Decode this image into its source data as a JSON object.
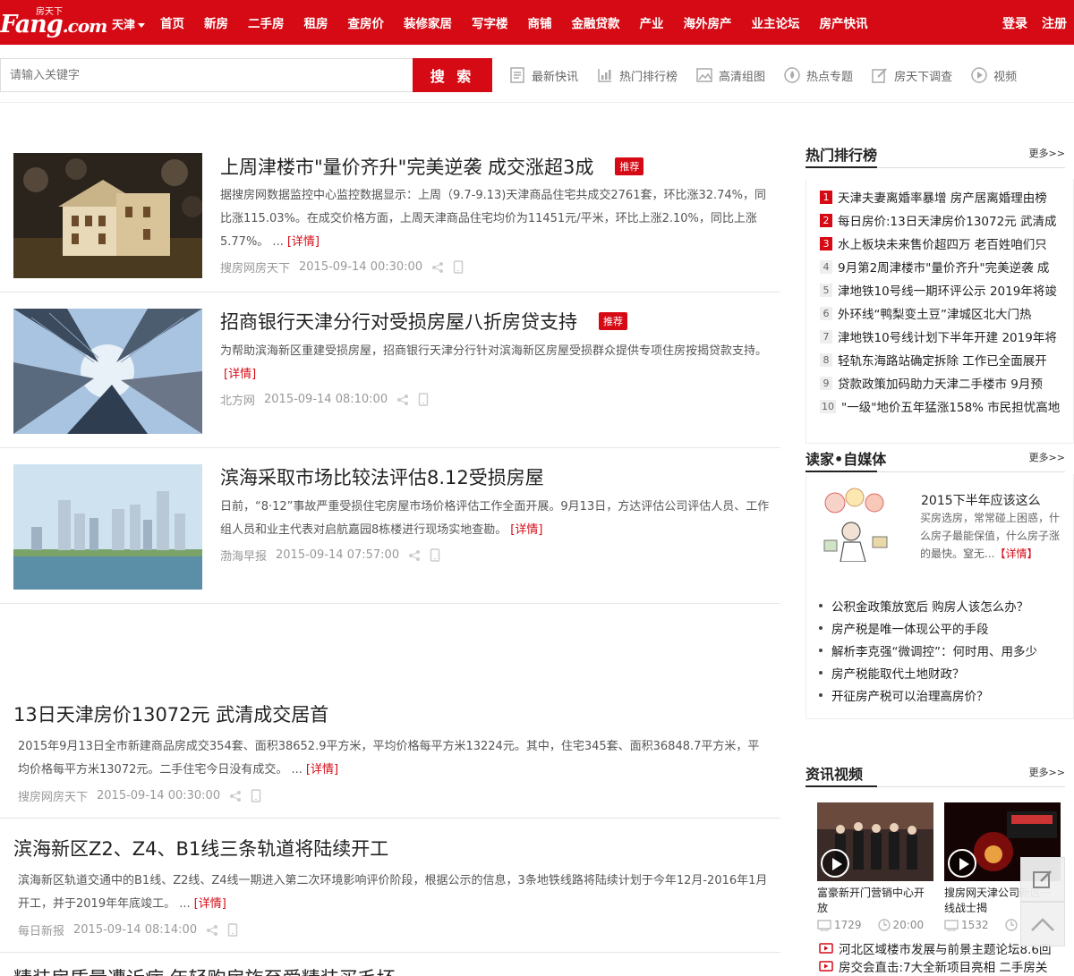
{
  "topbar": {
    "logo_small": "房天下",
    "logo_main": "Fang",
    "logo_suffix": ".com",
    "city": "天津",
    "nav": [
      "首页",
      "新房",
      "二手房",
      "租房",
      "查房价",
      "装修家居",
      "写字楼",
      "商铺",
      "金融贷款",
      "产业",
      "海外房产",
      "业主论坛",
      "房产快讯"
    ],
    "login": "登录",
    "register": "注册",
    "brand_color": "#d50a15"
  },
  "search": {
    "placeholder": "请输入关键字",
    "button": "搜 索",
    "quick_links": [
      {
        "label": "最新快讯",
        "icon": "news-icon"
      },
      {
        "label": "热门排行榜",
        "icon": "ranking-icon"
      },
      {
        "label": "高清组图",
        "icon": "image-icon"
      },
      {
        "label": "热点专题",
        "icon": "flame-icon"
      },
      {
        "label": "房天下调查",
        "icon": "survey-icon"
      },
      {
        "label": "视频",
        "icon": "play-icon"
      }
    ]
  },
  "articles": [
    {
      "title": "上周津楼市\"量价齐升\"完美逆袭 成交涨超3成",
      "tag": "推荐",
      "body": "据搜房网数据监控中心监控数据显示：上周（9.7-9.13)天津商品住宅共成交2761套，环比涨32.74%，同比涨115.03%。在成交价格方面，上周天津商品住宅均价为11451元/平米，环比上涨2.10%，同比上涨5.77%。 ...",
      "more": "[详情]",
      "source": "搜房网房天下",
      "time": "2015-09-14 00:30:00"
    },
    {
      "title": "招商银行天津分行对受损房屋八折房贷支持",
      "tag": "推荐",
      "body": "为帮助滨海新区重建受损房屋，招商银行天津分行针对滨海新区房屋受损群众提供专项住房按揭贷款支持。",
      "more": "[详情]",
      "source": "北方网",
      "time": "2015-09-14 08:10:00"
    },
    {
      "title": "滨海采取市场比较法评估8.12受损房屋",
      "body": "日前，“8·12”事故严重受损住宅房屋市场价格评估工作全面开展。9月13日，方达评估公司评估人员、工作组人员和业主代表对启航嘉园8栋楼进行现场实地查勘。",
      "more": "[详情]",
      "source": "渤海早报",
      "time": "2015-09-14 07:57:00"
    },
    {
      "title": "13日天津房价13072元 武清成交居首",
      "body": "2015年9月13日全市新建商品房成交354套、面积38652.9平方米，平均价格每平方米13224元。其中，住宅345套、面积36848.7平方米，平均价格每平方米13072元。二手住宅今日没有成交。 ...",
      "more": "[详情]",
      "source": "搜房网房天下",
      "time": "2015-09-14 00:30:00"
    },
    {
      "title": "滨海新区Z2、Z4、B1线三条轨道将陆续开工",
      "body": "滨海新区轨道交通中的B1线、Z2线、Z4线一期进入第二次环境影响评价阶段，根据公示的信息，3条地铁线路将陆续计划于今年12月-2016年1月开工，并于2019年年底竣工。 ...",
      "more": "[详情]",
      "source": "每日新报",
      "time": "2015-09-14 08:14:00"
    },
    {
      "title": "精装房质量遭诉病 年轻购房族至爱精装买毛坯"
    }
  ],
  "sidebar": {
    "rank": {
      "title": "热门排行榜",
      "more": "更多>>",
      "items": [
        {
          "n": "1",
          "text": "天津夫妻离婚率暴增 房产居离婚理由榜"
        },
        {
          "n": "2",
          "text": "每日房价:13日天津房价13072元 武清成"
        },
        {
          "n": "3",
          "text": "水上板块未来售价超四万 老百姓咱们只"
        },
        {
          "n": "4",
          "text": "9月第2周津楼市\"量价齐升\"完美逆袭 成"
        },
        {
          "n": "5",
          "text": "津地铁10号线一期环评公示 2019年将竣"
        },
        {
          "n": "6",
          "text": "外环线“鸭梨变土豆”津城区北大门热"
        },
        {
          "n": "7",
          "text": "津地铁10号线计划下半年开建 2019年将"
        },
        {
          "n": "8",
          "text": "轻轨东海路站确定拆除 工作已全面展开"
        },
        {
          "n": "9",
          "text": "贷款政策加码助力天津二手楼市 9月预"
        },
        {
          "n": "10",
          "text": "\"一级\"地价五年猛涨158% 市民担忧高地"
        }
      ]
    },
    "media": {
      "title": "读家•自媒体",
      "more": "更多>>",
      "feature_title": "2015下半年应该这么",
      "feature_text": "买房选房，常常碰上困惑，什么房子最能保值，什么房子涨的最快。窒无...",
      "feature_more": "【详情】",
      "list": [
        "公积金政策放宽后 购房人该怎么办？",
        "房产税是唯一体现公平的手段",
        "解析李克强“微调控”：何时用、用多少",
        "房产税能取代土地财政？",
        "开征房产税可以治理高房价？"
      ]
    },
    "video": {
      "title": "资讯视频",
      "more": "更多>>",
      "items": [
        {
          "caption": "富豪新开门营销中心开放",
          "views": "1729",
          "duration": "20:00"
        },
        {
          "caption": "搜房网天津公司新区一线战士揭",
          "views": "1532",
          "duration": ""
        }
      ],
      "list": [
        "河北区域楼市发展与前景主题论坛8.6回",
        "房交会直击:7大全新项目亮相 二手房关"
      ]
    }
  }
}
